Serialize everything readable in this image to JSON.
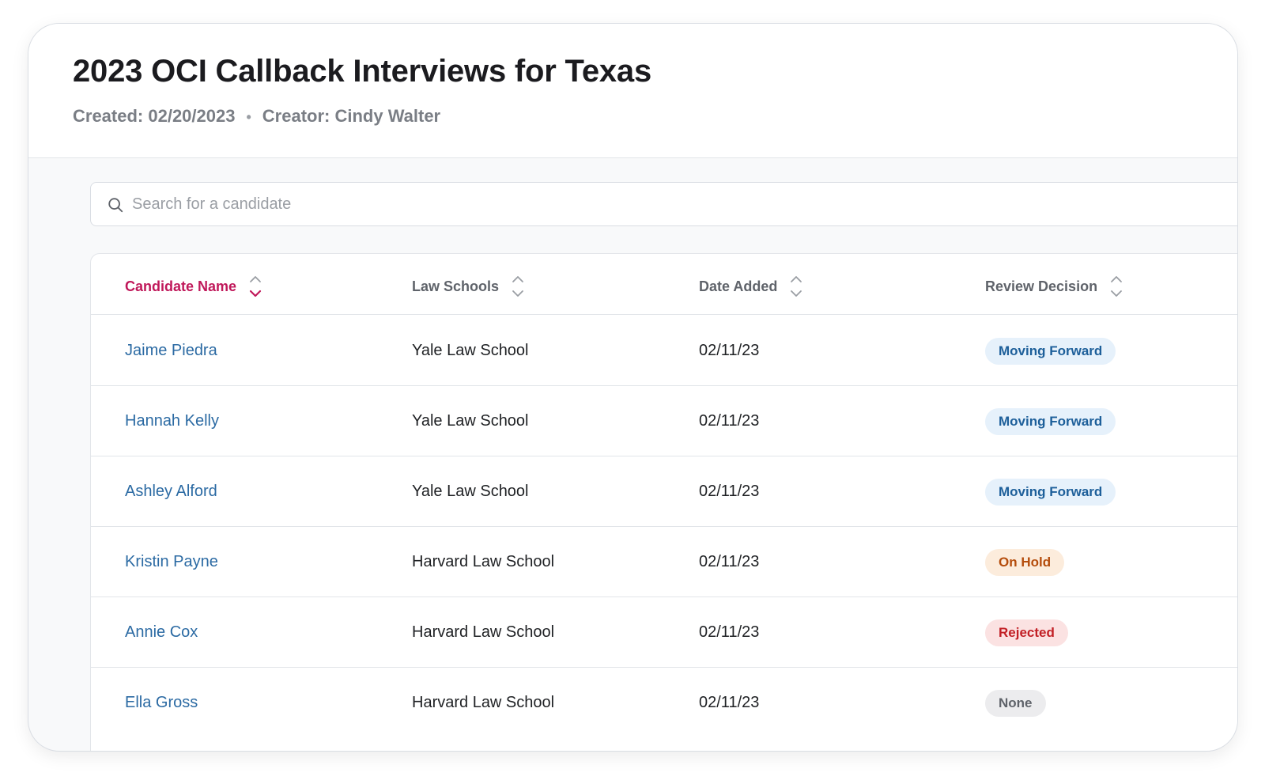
{
  "header": {
    "title": "2023 OCI Callback Interviews for Texas",
    "created": "Created: 02/20/2023",
    "separator": "•",
    "creator": "Creator: Cindy Walter"
  },
  "search": {
    "placeholder": "Search for a candidate",
    "value": "",
    "icon": "search-icon"
  },
  "table": {
    "columns": [
      {
        "label": "Candidate Name",
        "sort": "descending",
        "active": true
      },
      {
        "label": "Law Schools",
        "sort": "none",
        "active": false
      },
      {
        "label": "Date Added",
        "sort": "none",
        "active": false
      },
      {
        "label": "Review Decision",
        "sort": "none",
        "active": false
      }
    ],
    "rows": [
      {
        "name": "Jaime Piedra",
        "school": "Yale Law School",
        "date": "02/11/23",
        "decision": "Moving Forward",
        "status": "forward"
      },
      {
        "name": "Hannah Kelly",
        "school": "Yale Law School",
        "date": "02/11/23",
        "decision": "Moving Forward",
        "status": "forward"
      },
      {
        "name": "Ashley Alford",
        "school": "Yale Law School",
        "date": "02/11/23",
        "decision": "Moving Forward",
        "status": "forward"
      },
      {
        "name": "Kristin Payne",
        "school": "Harvard Law School",
        "date": "02/11/23",
        "decision": "On Hold",
        "status": "hold"
      },
      {
        "name": "Annie Cox",
        "school": "Harvard Law School",
        "date": "02/11/23",
        "decision": "Rejected",
        "status": "rejected"
      },
      {
        "name": "Ella Gross",
        "school": "Harvard Law School",
        "date": "02/11/23",
        "decision": "None",
        "status": "none"
      }
    ]
  },
  "colors": {
    "accent": "#c0185a",
    "link": "#2b6aa3",
    "status": {
      "forward": {
        "bg": "#e6f1fb",
        "fg": "#1d5f9a"
      },
      "hold": {
        "bg": "#fcecdc",
        "fg": "#b54d0c"
      },
      "rejected": {
        "bg": "#fbe2e2",
        "fg": "#c21f25"
      },
      "none": {
        "bg": "#ececee",
        "fg": "#5f636a"
      }
    }
  }
}
